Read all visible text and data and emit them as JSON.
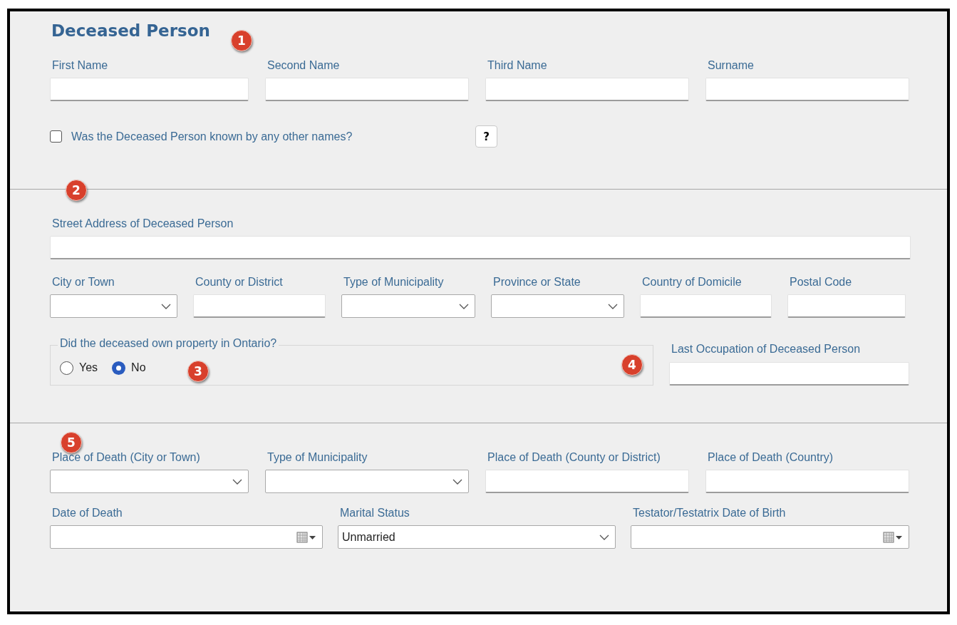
{
  "title": "Deceased Person",
  "callouts": [
    "1",
    "2",
    "3",
    "4",
    "5"
  ],
  "name_fields": [
    {
      "label": "First Name",
      "kind": "text"
    },
    {
      "label": "Second Name",
      "kind": "text"
    },
    {
      "label": "Third Name",
      "kind": "text"
    },
    {
      "label": "Surname",
      "kind": "text"
    }
  ],
  "other_names": {
    "label": "Was the Deceased Person known by any other names?",
    "checked": false
  },
  "help_button": "?",
  "address": {
    "label": "Street Address of Deceased Person"
  },
  "address_fields": [
    {
      "label": "City or Town",
      "kind": "dropdown"
    },
    {
      "label": "County or District",
      "kind": "text"
    },
    {
      "label": "Type of Municipality",
      "kind": "dropdown"
    },
    {
      "label": "Province or State",
      "kind": "dropdown"
    },
    {
      "label": "Country of Domicile",
      "kind": "text"
    },
    {
      "label": "Postal Code",
      "kind": "text"
    }
  ],
  "property": {
    "legend": "Did the deceased own property in Ontario?",
    "options": [
      {
        "label": "Yes",
        "selected": false
      },
      {
        "label": "No",
        "selected": true
      }
    ]
  },
  "occupation": {
    "label": "Last Occupation of Deceased Person"
  },
  "death_fields": [
    {
      "label": "Place of Death (City or Town)",
      "kind": "dropdown"
    },
    {
      "label": "Type of Municipality",
      "kind": "dropdown"
    },
    {
      "label": "Place of Death (County or District)",
      "kind": "text"
    },
    {
      "label": "Place of Death (Country)",
      "kind": "text"
    }
  ],
  "date_fields": [
    {
      "label": "Date of Death",
      "kind": "date"
    },
    {
      "label": "Marital Status",
      "kind": "dropdown",
      "value": "Unmarried"
    },
    {
      "label": "Testator/Testatrix Date of Birth",
      "kind": "date"
    }
  ]
}
